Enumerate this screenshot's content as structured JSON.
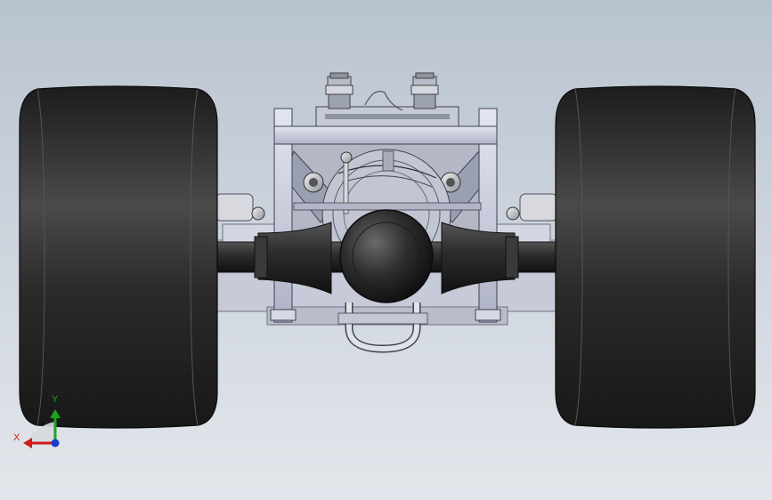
{
  "viewport": {
    "background_top": "#b9c3d0",
    "background_bottom": "#e3e7ec"
  },
  "model": {
    "view": "front view",
    "parts": [
      "left-tire",
      "right-tire",
      "rear-axle",
      "differential",
      "engine",
      "frame",
      "intake-stacks"
    ],
    "tire_color": "#2a2a2a",
    "frame_color": "#c9ccdc"
  },
  "triad": {
    "x_label": "X",
    "y_label": "Y",
    "x_color": "#d11a1a",
    "y_color": "#1aa51a",
    "z_color": "#1a3ad1"
  }
}
